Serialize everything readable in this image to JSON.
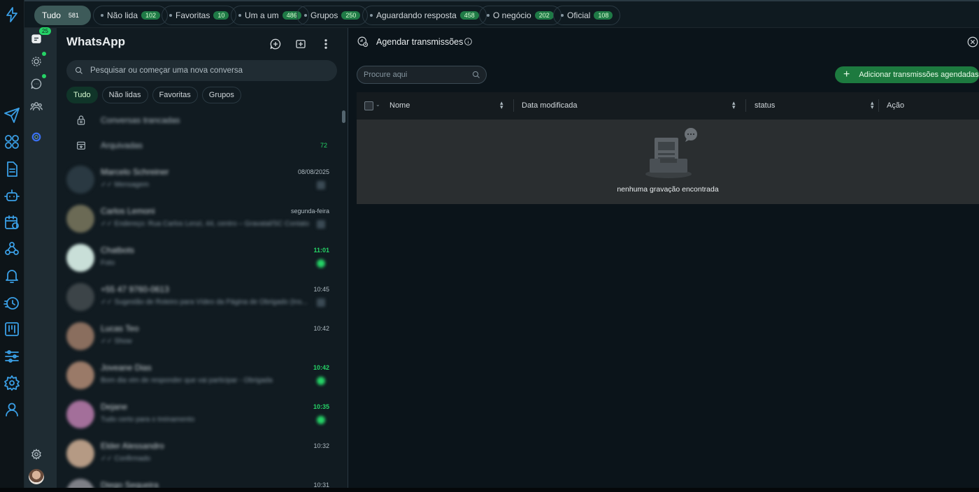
{
  "filter_bar": {
    "chips": [
      {
        "label": "Tudo",
        "count": "581",
        "active": true
      },
      {
        "label": "Não lida",
        "count": "102",
        "active": false
      },
      {
        "label": "Favoritas",
        "count": "10",
        "active": false
      },
      {
        "label": "Um a um",
        "count": "486",
        "active": false
      },
      {
        "label": "Grupos",
        "count": "250",
        "active": false
      },
      {
        "label": "Aguardando resposta",
        "count": "458",
        "active": false
      },
      {
        "label": "O negócio",
        "count": "202",
        "active": false
      },
      {
        "label": "Oficial",
        "count": "108",
        "active": false
      }
    ]
  },
  "ext_rail": {
    "icons": [
      "lightning-icon",
      "send-icon",
      "grid-icon",
      "document-icon",
      "robot-icon",
      "calendar-clock-icon",
      "webhook-icon",
      "bell-icon",
      "stopwatch-icon",
      "kanban-icon",
      "sliders-icon",
      "settings-icon",
      "user-icon"
    ]
  },
  "nav": {
    "chats_badge": "25",
    "icons": [
      "chats-icon",
      "status-icon",
      "channels-icon",
      "communities-icon",
      "meta-ai-icon",
      "settings-icon",
      "profile-avatar"
    ]
  },
  "chat_panel": {
    "title": "WhatsApp",
    "search_placeholder": "Pesquisar ou começar uma nova conversa",
    "filters": [
      "Tudo",
      "Não lidas",
      "Favoritas",
      "Grupos"
    ],
    "special_rows": [
      {
        "label": "Conversas trancadas",
        "count": ""
      },
      {
        "label": "Arquivadas",
        "count": "72"
      }
    ],
    "chats": [
      {
        "name": "Marcelo Schreiner",
        "preview": "✓✓ Mensagem",
        "time": "08/08/2025",
        "time_green": false
      },
      {
        "name": "Carlos Lemoni",
        "preview": "✓✓ Endereço: Rua Carlos Lenzi, 44, centro – Gravatal/SC Contato",
        "time": "segunda-feira",
        "time_green": false
      },
      {
        "name": "Chatbots",
        "preview": "Foto",
        "time": "11:01",
        "time_green": true
      },
      {
        "name": "+55 47 9760-0613",
        "preview": "✓✓ Sugestão de Roteiro para Vídeo da Página de Obrigado (Ins...",
        "time": "10:45",
        "time_green": false
      },
      {
        "name": "Lucas Teo",
        "preview": "✓✓ Show",
        "time": "10:42",
        "time_green": false
      },
      {
        "name": "Joveane Dias",
        "preview": "Bom dia vim de responder que vai participar - Obrigada",
        "time": "10:42",
        "time_green": true
      },
      {
        "name": "Dejane",
        "preview": "Tudo certo para o treinamento",
        "time": "10:35",
        "time_green": true
      },
      {
        "name": "Elder Alessandro",
        "preview": "✓✓ Confirmado",
        "time": "10:32",
        "time_green": false
      },
      {
        "name": "Diego Sequeira",
        "preview": "",
        "time": "10:31",
        "time_green": false
      }
    ]
  },
  "main_panel": {
    "title": "Agendar transmissões",
    "search_placeholder": "Procure aqui",
    "add_button": "Adicionar transmissões agendadas",
    "columns": [
      "Nome",
      "Data modificada",
      "status",
      "Ação"
    ],
    "empty_message": "nenhuma gravação encontrada"
  },
  "colors": {
    "accent_green": "#25d366",
    "button_green": "#1d7a3f",
    "rail_blue": "#3a9fe6"
  }
}
